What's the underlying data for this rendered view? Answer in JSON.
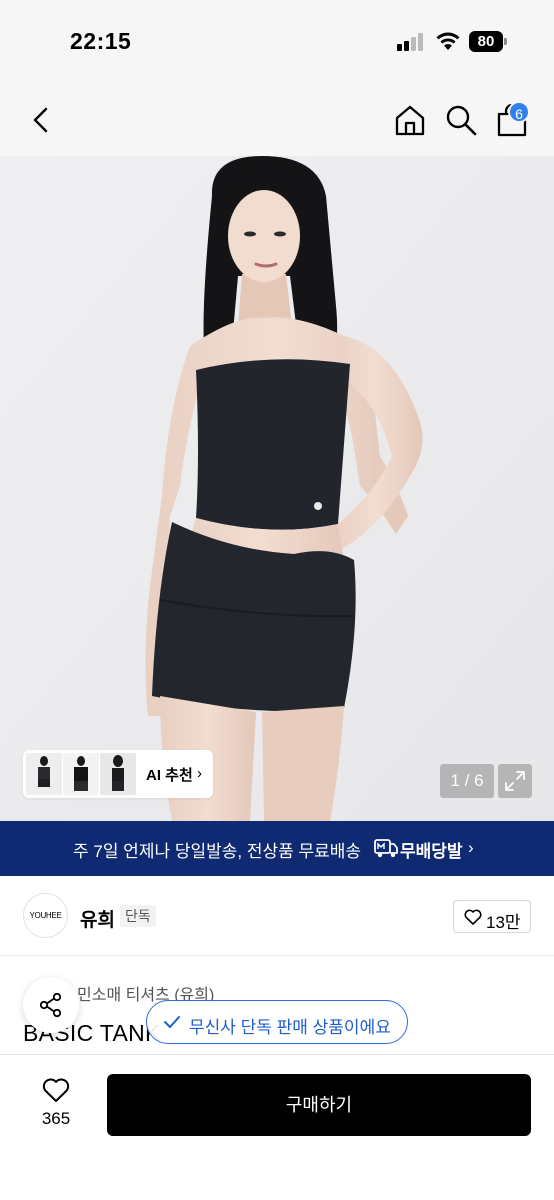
{
  "status_bar": {
    "time": "22:15",
    "battery": "80"
  },
  "nav": {
    "cart_count": "6"
  },
  "hero": {
    "ai_label": "AI 추천",
    "ai_chevron": "›",
    "page_indicator": "1 / 6"
  },
  "delivery": {
    "text": "주 7일 언제나 당일발송, 전상품 무료배송",
    "brand": "무배당발",
    "chevron": "›"
  },
  "brand": {
    "logo_text": "YOUHEE",
    "name": "유희",
    "tag": "단독",
    "like_count": "13만"
  },
  "product": {
    "category": "민소매 티셔츠 (유희)",
    "name": "BASIC TANK"
  },
  "toast": {
    "text": "무신사 단독 판매 상품이에요"
  },
  "bottom_bar": {
    "like_count": "365",
    "buy_label": "구매하기"
  },
  "colors": {
    "accent": "#2f80ed",
    "banner": "#0f2a73",
    "toast": "#1f5ecf",
    "buy_button": "#000000"
  }
}
